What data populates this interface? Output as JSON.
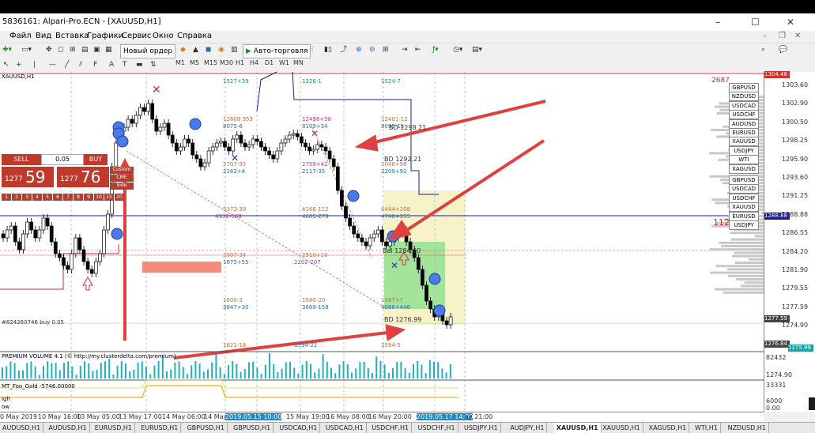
{
  "window": {
    "title": "5836161: Alpari-Pro.ECN - [XAUUSD,H1]",
    "controls": [
      "–",
      "☐",
      "✕"
    ]
  },
  "menu": [
    "Файл",
    "Вид",
    "Вставка",
    "Графики",
    "Сервис",
    "Окно",
    "Справка"
  ],
  "toolbar": {
    "new_order": "Новый ордер",
    "autotrading": "Авто-торговля",
    "timeframes": [
      "M1",
      "M5",
      "M15",
      "M30",
      "H1",
      "H4",
      "D1",
      "W1",
      "MN"
    ]
  },
  "chart": {
    "symbol_label": "XAUUSD,H1",
    "trade_panel": {
      "sell": "SELL",
      "buy": "BUY",
      "lot": "0.05",
      "bid_prefix": "1277",
      "bid_big": "59",
      "ask_prefix": "1277",
      "ask_big": "76",
      "tab_labels": [
        "Custom",
        "CME",
        "Side"
      ]
    },
    "tiny_numbers_row": [
      "1",
      "2",
      "3",
      "4",
      "5",
      "6",
      "7",
      "8",
      "9",
      "10",
      "15",
      "20"
    ],
    "left_note": "#824260746 buy 0.05",
    "level_texts": [
      {
        "t": "1527+39"
      },
      {
        "t": "1326-1"
      },
      {
        "t": "1524-7"
      },
      {
        "t": "12608 353"
      },
      {
        "t": "8075-6"
      },
      {
        "t": "12498+58"
      },
      {
        "t": "8109+34"
      },
      {
        "t": "12401-12"
      },
      {
        "t": "8095-15"
      },
      {
        "t": "2707-95"
      },
      {
        "t": "2162+4"
      },
      {
        "t": "2759+42"
      },
      {
        "t": "2117-35"
      },
      {
        "t": "2046+98"
      },
      {
        "t": "2209+92"
      },
      {
        "t": "5372-39"
      },
      {
        "t": "4932-568"
      },
      {
        "t": "6166 112"
      },
      {
        "t": "4605-279"
      },
      {
        "t": "6444+208"
      },
      {
        "t": "4740+155"
      },
      {
        "t": "2007-24"
      },
      {
        "t": "1675+55"
      },
      {
        "t": "2310+10"
      },
      {
        "t": "2202-207"
      },
      {
        "t": "1600-3"
      },
      {
        "t": "3847+30"
      },
      {
        "t": "1580-20"
      },
      {
        "t": "3689-158"
      },
      {
        "t": "1587+7"
      },
      {
        "t": "4086+446"
      },
      {
        "t": "1621-18"
      },
      {
        "t": "1594-22"
      },
      {
        "t": "1594-5"
      }
    ],
    "bd_labels": [
      "BD 1298.21",
      "BD 1292.21",
      "BD 1276.99",
      "Bal 1284.60"
    ],
    "red_number": "1129",
    "small_right_numbers": [
      "2687"
    ],
    "indicator1": "PREMIUM VOLUME 4.1 (© http://my.clusterdelta.com/premium)",
    "indicator1_value": "82432",
    "indicator2": "MT_Foo_Gold -5746.00000",
    "indicator2_value": "33331",
    "indicator2_extra": "igh",
    "indicator2_low": "ow",
    "indicator2_scale": [
      "33331",
      "6000",
      "0.00"
    ]
  },
  "symbol_list": [
    "GBPUSD",
    "NZDUSD",
    "USDCAD",
    "USDCHF",
    "AUDUSD",
    "EURUSD",
    "XAUUSD",
    "USDJPY",
    "WTI",
    "XAGUSD",
    "GBPUSD",
    "USDCAD",
    "USDCHF",
    "XAUUSD",
    "EURUSD",
    "USDJPY"
  ],
  "price_scale": {
    "labels": [
      "1303.60",
      "1302.90",
      "1300.50",
      "1298.25",
      "1295.90",
      "1293.60",
      "1291.25",
      "1288.88",
      "1286.55",
      "1284.20",
      "1281.90",
      "1279.55",
      "1277.59",
      "1274.90"
    ],
    "current_price": "1277.59",
    "top_label": "1304.46",
    "highlight_label": "1288.88",
    "bottom_label": "1274.90",
    "vol_labels": [
      "1274.90",
      "1272.55"
    ]
  },
  "right_scale_extra": [
    "1276.84",
    "1275.99"
  ],
  "date_axis": [
    "0 May 2019",
    "10 May 16:00",
    "13 May 05:00",
    "13 May 17:00",
    "14 May 06:00",
    "14 May 18:00",
    "2019.05.15 10:00",
    "15 May 19:00",
    "16 May 08:00",
    "16 May 20:00",
    "2019.05.17 14:00",
    "ay 21:00"
  ],
  "tabs": [
    "AUDUSD,H1",
    "AUDUSD,H1",
    "EURUSD,H1",
    "EURUSD,H1",
    "GBPUSD,H1",
    "GBPUSD,H1",
    "USDCAD,H1",
    "USDCAD,H1",
    "USDCHF,H1",
    "USDCHF,H1",
    "USDJPY,H1",
    "AUDJPY,H1",
    "XAUUSD,H1",
    "XAUUSD,H1",
    "XAGUSD,H1",
    "WTI,H1",
    "NZDUSD,H1"
  ],
  "active_tab_index": 12,
  "colors": {
    "sell_red": "#c0392b",
    "arrow_red": "#e04040",
    "blue_line": "#1a1aa0",
    "green_zone": "#7ddc7d",
    "yellow_zone": "#f7f2c8",
    "salmon_box": "#f48b7c",
    "teal_text": "#1a8a6a",
    "magenta_text": "#c03090",
    "volume_teal": "#20b0c0",
    "ma_orange": "#f0b020"
  }
}
